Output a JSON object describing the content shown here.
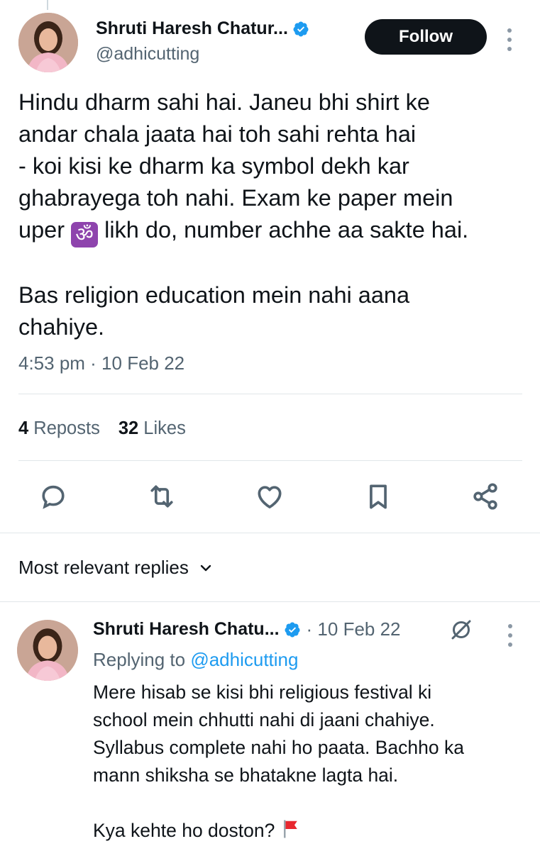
{
  "tweet": {
    "author_name": "Shruti Haresh Chatur...",
    "handle": "@adhicutting",
    "follow_label": "Follow",
    "text_part1": "Hindu dharm sahi hai. Janeu bhi shirt ke\nandar chala jaata hai toh sahi rehta hai\n- koi kisi ke dharm ka symbol dekh kar\nghabrayega toh nahi. Exam ke paper mein\nuper ",
    "om_symbol": "ॐ",
    "text_part2": " likh do, number achhe aa sakte hai.\n\nBas religion education mein nahi aana\nchahiye.",
    "timestamp": "4:53 pm · 10 Feb 22"
  },
  "stats": {
    "reposts_count": "4",
    "reposts_label": "Reposts",
    "likes_count": "32",
    "likes_label": "Likes"
  },
  "actions": [
    "reply-icon",
    "repost-icon",
    "like-icon",
    "bookmark-icon",
    "share-icon"
  ],
  "replies_filter": {
    "label": "Most relevant replies"
  },
  "reply": {
    "author_name": "Shruti Haresh Chatu...",
    "date": "· 10 Feb 22",
    "replying_prefix": "Replying to ",
    "replying_mention": "@adhicutting",
    "text": "Mere hisab se kisi bhi religious festival ki\nschool mein chhutti nahi di jaani chahiye.\nSyllabus complete nahi ho paata. Bachho ka\nmann shiksha se bhatakne lagta hai.\n\nKya kehte ho doston? "
  },
  "colors": {
    "text": "#0f1419",
    "secondary": "#536471",
    "link": "#1d9bf0",
    "verified": "#1d9bf0",
    "om_bg": "#8e44ad"
  }
}
